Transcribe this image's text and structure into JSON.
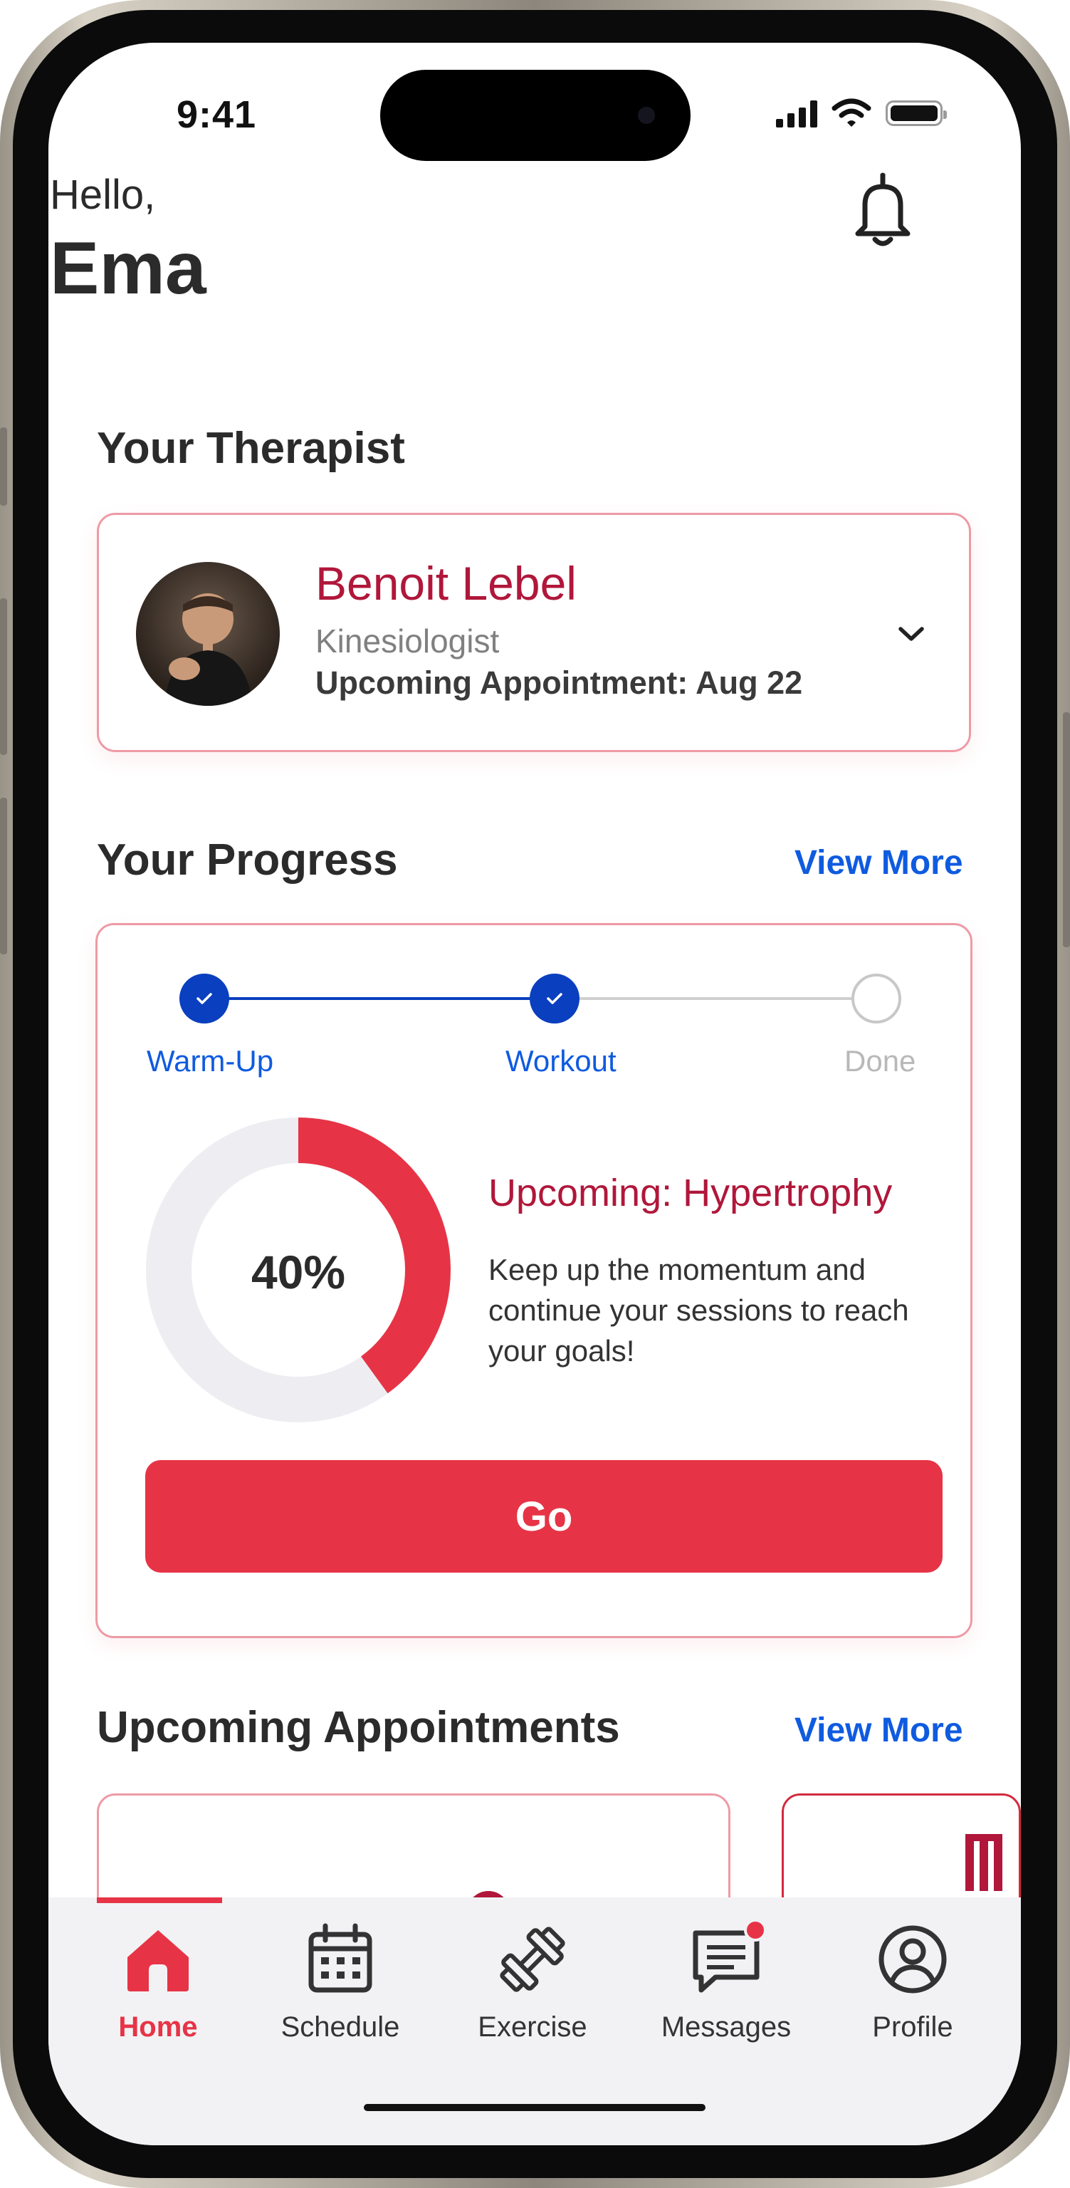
{
  "status_bar": {
    "time": "9:41"
  },
  "greeting": {
    "hello": "Hello,",
    "name": "Ema"
  },
  "therapist_section": {
    "title": "Your Therapist",
    "name": "Benoit Lebel",
    "role": "Kinesiologist",
    "appointment": "Upcoming Appointment: Aug 22"
  },
  "progress_section": {
    "title": "Your Progress",
    "view_more": "View More",
    "steps": [
      {
        "label": "Warm-Up",
        "state": "done"
      },
      {
        "label": "Workout",
        "state": "done"
      },
      {
        "label": "Done",
        "state": "todo"
      }
    ],
    "percent_value": 0.4,
    "percent_label": "40%",
    "upcoming_title": "Upcoming: Hypertrophy",
    "upcoming_desc": "Keep up the momentum and continue your sessions to reach your goals!",
    "go_label": "Go"
  },
  "appointments_section": {
    "title": "Upcoming Appointments",
    "view_more": "View More"
  },
  "tabs": [
    {
      "label": "Home",
      "icon": "home-icon",
      "active": true
    },
    {
      "label": "Schedule",
      "icon": "calendar-icon",
      "active": false
    },
    {
      "label": "Exercise",
      "icon": "dumbbell-icon",
      "active": false
    },
    {
      "label": "Messages",
      "icon": "message-icon",
      "active": false,
      "badge": true
    },
    {
      "label": "Profile",
      "icon": "profile-icon",
      "active": false
    }
  ],
  "colors": {
    "accent_red": "#e63446",
    "therapist_name": "#b0173a",
    "link_blue": "#0f5be0",
    "step_blue": "#0a3fbf"
  }
}
